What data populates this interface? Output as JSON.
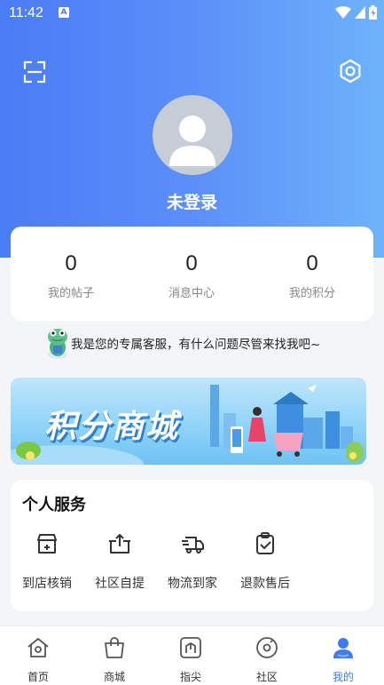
{
  "status_bar": {
    "time": "11:42",
    "notification_badge": "A"
  },
  "profile": {
    "username": "未登录"
  },
  "stats": [
    {
      "value": "0",
      "label": "我的帖子"
    },
    {
      "value": "0",
      "label": "消息中心"
    },
    {
      "value": "0",
      "label": "我的积分"
    }
  ],
  "service_tip": "我是您的专属客服，有什么问题尽管来找我吧~",
  "banner": {
    "title": "积分商城"
  },
  "services": {
    "title": "个人服务",
    "items": [
      {
        "label": "到店核销",
        "icon": "store-icon"
      },
      {
        "label": "社区自提",
        "icon": "pickup-box-icon"
      },
      {
        "label": "物流到家",
        "icon": "delivery-truck-icon"
      },
      {
        "label": "退款售后",
        "icon": "refund-clipboard-icon"
      }
    ]
  },
  "tabbar": {
    "items": [
      {
        "label": "首页",
        "icon": "home-icon"
      },
      {
        "label": "商城",
        "icon": "shop-bag-icon"
      },
      {
        "label": "指尖",
        "icon": "fingertip-icon"
      },
      {
        "label": "社区",
        "icon": "community-icon"
      },
      {
        "label": "我的",
        "icon": "profile-icon"
      }
    ],
    "active": "我的"
  },
  "colors": {
    "header_gradient_start": "#4a7cf6",
    "header_gradient_end": "#6eb3fb",
    "accent": "#3d7cf5"
  }
}
